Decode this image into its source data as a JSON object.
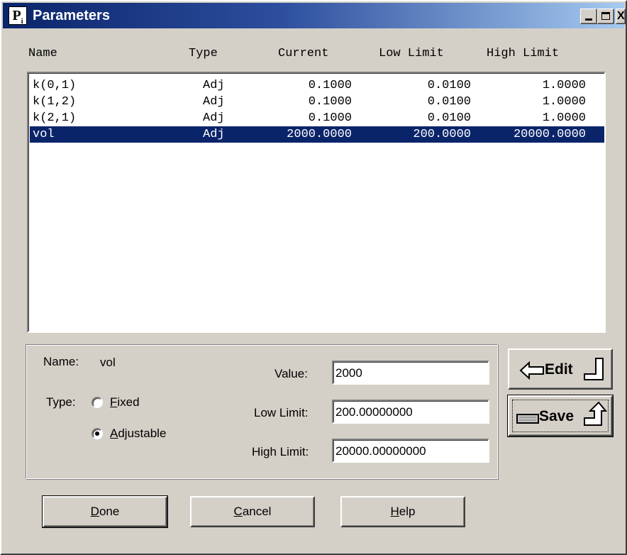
{
  "window": {
    "title": "Parameters",
    "icon_letter": "P",
    "icon_sub": "i",
    "close_glyph": "X"
  },
  "columns": {
    "name": "Name",
    "type": "Type",
    "current": "Current",
    "low": "Low Limit",
    "high": "High Limit"
  },
  "rows": [
    {
      "name": "k(0,1)",
      "type": "Adj",
      "current": "0.1000",
      "low": "0.0100",
      "high": "1.0000"
    },
    {
      "name": "k(1,2)",
      "type": "Adj",
      "current": "0.1000",
      "low": "0.0100",
      "high": "1.0000"
    },
    {
      "name": "k(2,1)",
      "type": "Adj",
      "current": "0.1000",
      "low": "0.0100",
      "high": "1.0000"
    },
    {
      "name": "vol",
      "type": "Adj",
      "current": "2000.0000",
      "low": "200.0000",
      "high": "20000.0000"
    }
  ],
  "selected_row_index": 3,
  "editor": {
    "name_label": "Name:",
    "name_value": "vol",
    "type_label": "Type:",
    "fixed_label_u": "F",
    "fixed_label_rest": "ixed",
    "adjustable_label_u": "A",
    "adjustable_label_rest": "djustable",
    "selected_type": "Adjustable",
    "value_label": "Value:",
    "value": "2000",
    "low_label": "Low Limit:",
    "low_value": "200.00000000",
    "high_label": "High Limit:",
    "high_value": "20000.00000000"
  },
  "side_buttons": {
    "edit": "Edit",
    "save": "Save"
  },
  "buttons": {
    "done_u": "D",
    "done_rest": "one",
    "cancel_u": "C",
    "cancel_rest": "ancel",
    "help_u": "H",
    "help_rest": "elp"
  }
}
